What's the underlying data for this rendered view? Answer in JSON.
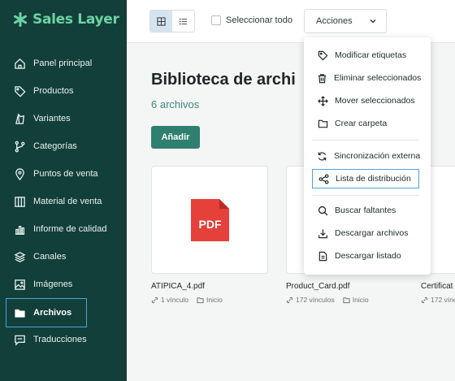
{
  "brand": {
    "name": "Sales Layer",
    "color": "#6fd3a4"
  },
  "sidebar": {
    "items": [
      {
        "label": "Panel principal",
        "icon": "home-icon"
      },
      {
        "label": "Productos",
        "icon": "tag-icon"
      },
      {
        "label": "Variantes",
        "icon": "variants-icon"
      },
      {
        "label": "Categorías",
        "icon": "branch-icon"
      },
      {
        "label": "Puntos de venta",
        "icon": "location-pin-icon"
      },
      {
        "label": "Material de venta",
        "icon": "columns-icon"
      },
      {
        "label": "Informe de calidad",
        "icon": "bar-chart-icon"
      },
      {
        "label": "Canales",
        "icon": "layers-icon"
      },
      {
        "label": "Imágenes",
        "icon": "image-icon"
      },
      {
        "label": "Archivos",
        "icon": "folder-icon",
        "active": true
      },
      {
        "label": "Traducciones",
        "icon": "chat-icon"
      }
    ]
  },
  "toolbar": {
    "select_all_label": "Seleccionar todo",
    "actions_label": "Acciones",
    "view_grid_icon": "grid-view-icon",
    "view_list_icon": "list-view-icon"
  },
  "main": {
    "title": "Biblioteca de archi",
    "count": "6 archivos",
    "add_label": "Añadir"
  },
  "files": [
    {
      "name": "ATIPICA_4.pdf",
      "links": "1 vínculo",
      "location": "Inicio"
    },
    {
      "name": "Product_Card.pdf",
      "links": "172 vínculos",
      "location": "Inicio"
    },
    {
      "name": "Certificat",
      "links": "172 víncu",
      "location": ""
    }
  ],
  "actions_menu": [
    {
      "label": "Modificar etiquetas",
      "icon": "tag-edit-icon"
    },
    {
      "label": "Eliminar seleccionados",
      "icon": "trash-icon"
    },
    {
      "label": "Mover seleccionados",
      "icon": "move-icon"
    },
    {
      "label": "Crear carpeta",
      "icon": "folder-outline-icon"
    },
    {
      "label": "Sincronización externa",
      "icon": "sync-icon"
    },
    {
      "label": "Lista de distribución",
      "icon": "share-icon",
      "highlighted": true
    },
    {
      "label": "Buscar faltantes",
      "icon": "search-icon"
    },
    {
      "label": "Descargar archivos",
      "icon": "download-icon"
    },
    {
      "label": "Descargar listado",
      "icon": "document-icon"
    }
  ],
  "colors": {
    "sidebar_bg": "#123f39",
    "accent": "#2e7f70",
    "focus": "#4aa6d8",
    "pdf_red": "#e5403a"
  },
  "pdf_badge": "PDF"
}
